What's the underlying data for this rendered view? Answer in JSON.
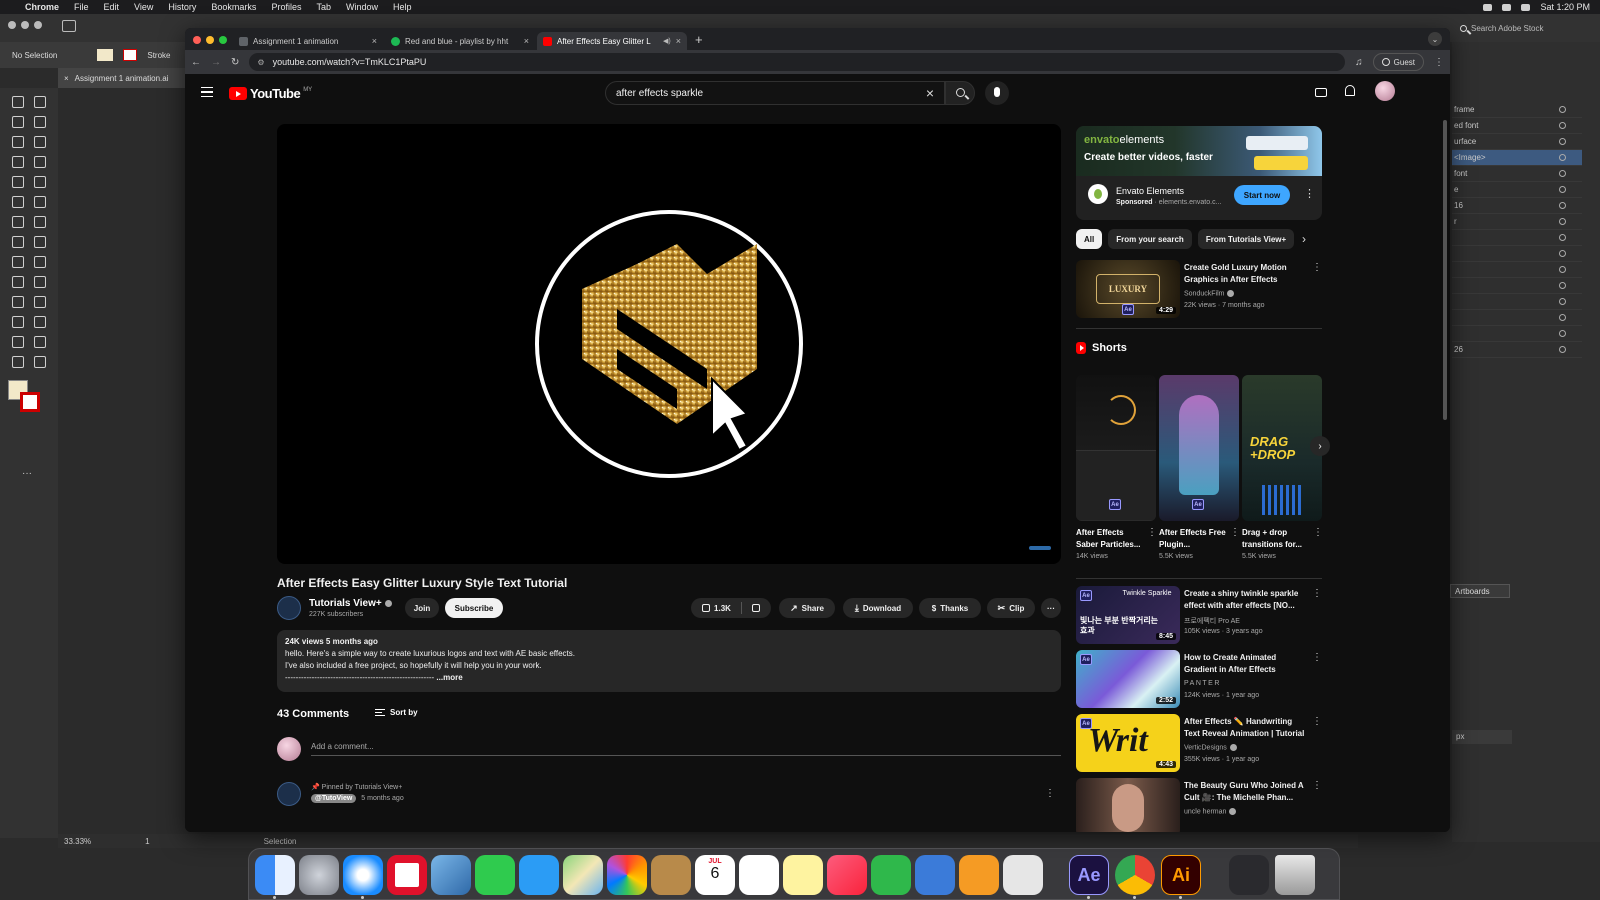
{
  "menubar": {
    "app": "Chrome",
    "items": [
      "File",
      "Edit",
      "View",
      "History",
      "Bookmarks",
      "Profiles",
      "Tab",
      "Window",
      "Help"
    ],
    "clock": "Sat 1:20 PM"
  },
  "illustrator": {
    "selection_label": "No Selection",
    "stroke_label": "Stroke",
    "doc_tab": "Assignment 1 animation.ai",
    "search_stock": "Search Adobe Stock",
    "layers": [
      "frame",
      "ed font",
      "urface",
      "<Image>",
      "font",
      "e",
      "16",
      "r",
      "",
      "",
      "",
      "",
      "",
      "",
      "",
      "26"
    ],
    "artboards_button": "Artboards",
    "unit": "px",
    "zoom": "33.33%",
    "artboard_number": "1",
    "status": "Selection"
  },
  "browser": {
    "tabs": [
      {
        "title": "Assignment 1 animation",
        "favicon_color": "#5f6368"
      },
      {
        "title": "Red and blue - playlist by hht",
        "favicon_color": "#1db954"
      },
      {
        "title": "After Effects Easy Glitter L",
        "favicon_color": "#ff0000"
      }
    ],
    "url": "youtube.com/watch?v=TmKLC1PtaPU",
    "guest_label": "Guest"
  },
  "youtube": {
    "logo_text": "YouTube",
    "country_code": "MY",
    "search_query": "after effects sparkle",
    "video": {
      "title": "After Effects Easy Glitter Luxury Style Text Tutorial",
      "channel": "Tutorials View+",
      "subscribers": "227K subscribers",
      "join": "Join",
      "subscribe": "Subscribe",
      "likes": "1.3K",
      "share": "Share",
      "download": "Download",
      "thanks": "Thanks",
      "clip": "Clip",
      "views_date": "24K views  5 months ago",
      "desc_line1": "hello. Here's a simple way to create luxurious logos and text with AE basic effects.",
      "desc_line2": "I've also included a free project, so hopefully it will help you in your work.",
      "desc_line3": "--------------------------------------------------------",
      "more": "...more"
    },
    "comments": {
      "count": "43 Comments",
      "sort_by": "Sort by",
      "add_placeholder": "Add a comment...",
      "pinned_by": "Pinned by Tutorials View+",
      "pinned_author": "@TutoView",
      "pinned_time": "5 months ago"
    },
    "ad": {
      "brand_a": "envato",
      "brand_b": "elements",
      "tagline": "Create better videos, faster",
      "name": "Envato Elements",
      "sponsored": "Sponsored",
      "domain": " · elements.envato.c...",
      "cta": "Start now"
    },
    "chips": [
      "All",
      "From your search",
      "From Tutorials View+"
    ],
    "recommendations": [
      {
        "title": "Create Gold Luxury Motion Graphics in After Effects",
        "channel": "SonduckFilm",
        "stats": "22K views · 7 months ago",
        "duration": "4:29",
        "thumb_text": "LUXURY"
      },
      {
        "title": "Create a shiny twinkle sparkle effect with after effects [NO...",
        "channel": "프로에펙티 Pro AE",
        "stats": "105K views · 3 years ago",
        "duration": "8:45",
        "thumb_text": "빛나는 부분 반짝거리는 효과",
        "thumb_sub": "Twinkle Sparkle"
      },
      {
        "title": "How to Create Animated Gradient in After Effects",
        "channel": "PANTER",
        "stats": "124K views · 1 year ago",
        "duration": "2:52",
        "thumb_text": ""
      },
      {
        "title": "After Effects ✏️ Handwriting Text Reveal Animation | Tutorial",
        "channel": "VerticDesigns",
        "stats": "355K views · 1 year ago",
        "duration": "4:43",
        "thumb_text": "Writ"
      },
      {
        "title": "The Beauty Guru Who Joined A Cult 🎥: The Michelle Phan...",
        "channel": "uncle herman",
        "stats": "",
        "duration": "",
        "thumb_text": ""
      }
    ],
    "shorts_label": "Shorts",
    "shorts": [
      {
        "title": "After Effects Saber Particles...",
        "views": "14K views"
      },
      {
        "title": "After Effects Free Plugin...",
        "views": "5.5K views"
      },
      {
        "title": "Drag + drop transitions for...",
        "views": "5.5K views",
        "thumb_text": "DRAG +DROP"
      }
    ]
  },
  "dock": {
    "apps": [
      "Finder",
      "Launchpad",
      "Safari",
      "Opera",
      "Preview",
      "FaceTime",
      "Messages",
      "Maps",
      "Photos",
      "Notes",
      "Calendar",
      "Reminders",
      "Stickies",
      "Music",
      "Numbers",
      "Keynote",
      "Pages",
      "Screenshot",
      "After Effects",
      "Chrome",
      "Illustrator",
      "Downloads",
      "Trash"
    ],
    "calendar_month": "JUL",
    "calendar_day": "6",
    "ae_label": "Ae",
    "ai_label": "Ai"
  },
  "colors": {
    "yt_red": "#ff0000",
    "yt_bg": "#0f0f0f",
    "cta_blue": "#3ea6ff",
    "envato_green": "#82b541"
  }
}
